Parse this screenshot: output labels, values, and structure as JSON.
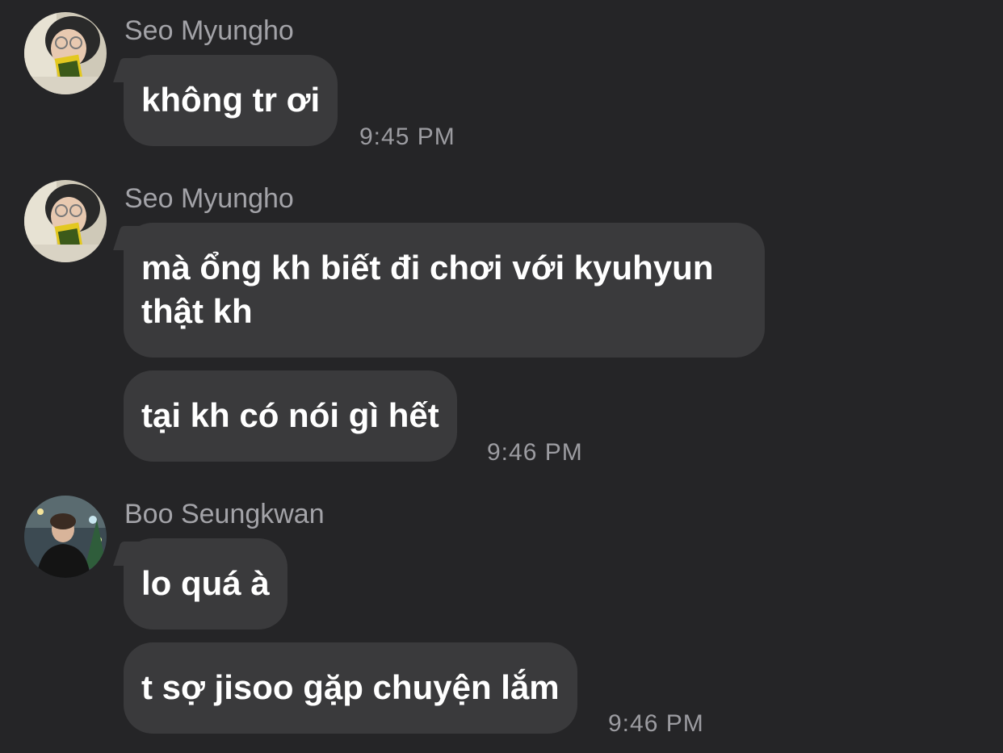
{
  "messages": [
    {
      "sender": "Seo Myungho",
      "bubbles": [
        "không tr ơi"
      ],
      "time": "9:45 PM"
    },
    {
      "sender": "Seo Myungho",
      "bubbles": [
        "mà ổng kh biết đi chơi với kyuhyun",
        "thật kh",
        "tại kh có nói gì hết"
      ],
      "time": "9:46 PM"
    },
    {
      "sender": "Boo Seungkwan",
      "bubbles": [
        "lo quá à",
        "t sợ jisoo gặp chuyện lắm"
      ],
      "time": "9:46 PM"
    }
  ],
  "colors": {
    "background": "#252527",
    "bubble": "#3a3a3c",
    "text": "#ffffff",
    "meta": "#a3a3a8"
  }
}
